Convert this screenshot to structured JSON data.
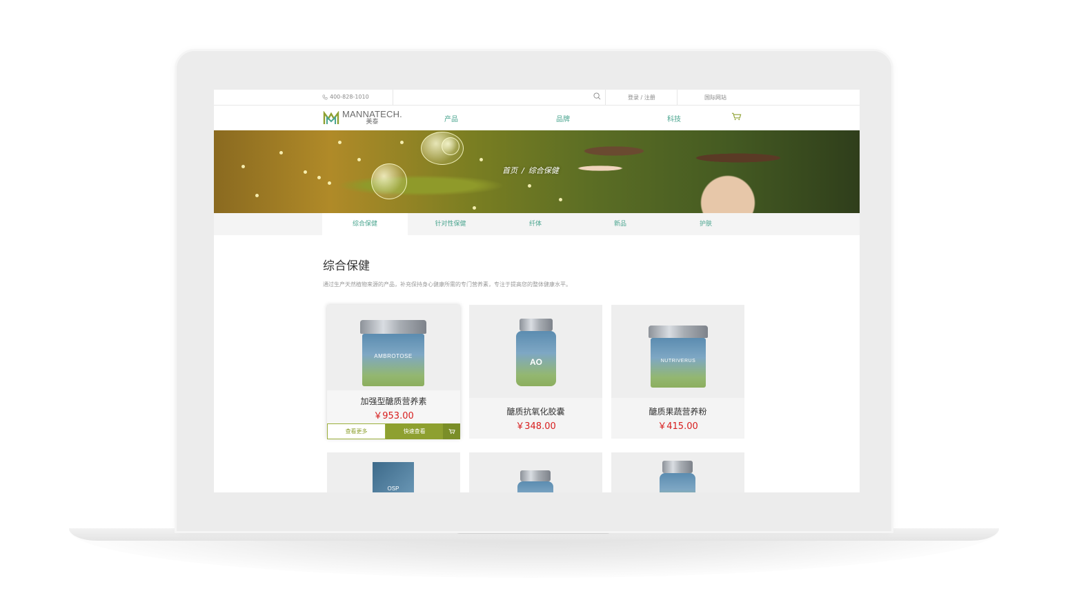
{
  "topbar": {
    "phone": "400-828-1010",
    "login": "登录 / 注册",
    "international": "国际网站"
  },
  "logo": {
    "brand": "MANNATECH.",
    "cn": "美泰"
  },
  "nav": {
    "items": [
      "产品",
      "品牌",
      "科技"
    ]
  },
  "breadcrumb": {
    "home": "首页",
    "separator": "/",
    "current": "综合保健"
  },
  "tabs": [
    "综合保健",
    "针对性保健",
    "纤体",
    "新品",
    "护肤"
  ],
  "section": {
    "title": "综合保健",
    "description": "通过生产天然植物来源的产品，补充保持身心健康所需的专门营养素，专注于提高您的整体健康水平。"
  },
  "products": [
    {
      "name": "加强型醣质营养素",
      "price": "￥953.00",
      "label": "AMBROTOSE",
      "more": "查看更多",
      "quick": "快速查看"
    },
    {
      "name": "醣质抗氧化胶囊",
      "price": "￥348.00",
      "label": "AO"
    },
    {
      "name": "醣质果蔬营养粉",
      "price": "￥415.00",
      "label": "NUTRIVERUS"
    }
  ],
  "products_row2": [
    {
      "label": "OSP"
    }
  ],
  "colors": {
    "accent": "#4aa58f",
    "button_green": "#8ea030",
    "price_red": "#d71d1d"
  }
}
